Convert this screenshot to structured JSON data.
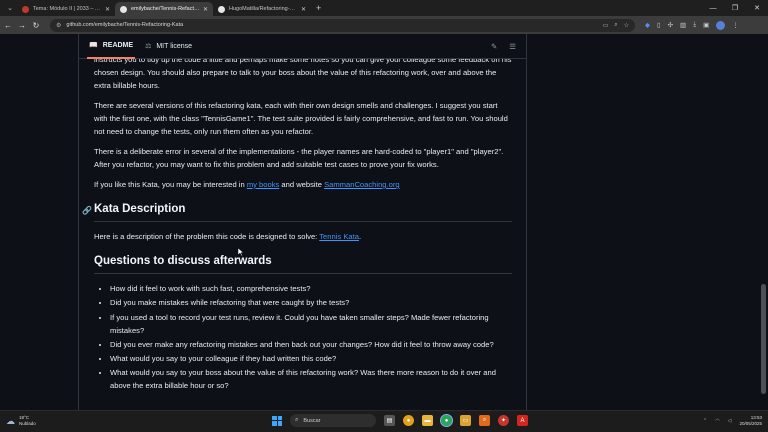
{
  "browser": {
    "tabs": [
      {
        "label": "Tema: Módulo II | 2033 – AMPI: ...",
        "active": false,
        "favicon_color": "#c0392b"
      },
      {
        "label": "emilybache/Tennis-Refactoring-...",
        "active": true,
        "favicon_color": "#e6e6e6"
      },
      {
        "label": "HugoMatilla/Refactoring-Samm...",
        "active": false,
        "favicon_color": "#e6e6e6"
      }
    ],
    "url": "github.com/emilybache/Tennis-Refactoring-Kata"
  },
  "readme": {
    "tab_readme": "README",
    "tab_license": "MIT license",
    "intro_partial": "Unfortunately he has now taken ill. He says he has completed the work, and the tests all pass. Your boss has asked you to take over from him. She wants you to spend an hour or so on the code so she can bill the client for the full 10 hours. She instructs you to tidy up the code a little and perhaps make some notes so you can give your colleague some feedback on his chosen design. You should also prepare to talk to your boss about the value of this refactoring work, over and above the extra billable hours.",
    "para_versions": "There are several versions of this refactoring kata, each with their own design smells and challenges. I suggest you start with the first one, with the class \"TennisGame1\". The test suite provided is fairly comprehensive, and fast to run. You should not need to change the tests, only run them often as you refactor.",
    "para_error": "There is a deliberate error in several of the implementations - the player names are hard-coded to \"player1\" and \"player2\". After you refactor, you may want to fix this problem and add suitable test cases to prove your fix works.",
    "like_prefix": "If you like this Kata, you may be interested in ",
    "like_link1": "my books",
    "like_mid": " and website ",
    "like_link2": "SammanCoaching.org",
    "h_kata": "Kata Description",
    "kata_prefix": "Here is a description of the problem this code is designed to solve: ",
    "kata_link": "Tennis Kata",
    "kata_suffix": ".",
    "h_questions": "Questions to discuss afterwards",
    "questions": [
      "How did it feel to work with such fast, comprehensive tests?",
      "Did you make mistakes while refactoring that were caught by the tests?",
      "If you used a tool to record your test runs, review it. Could you have taken smaller steps? Made fewer refactoring mistakes?",
      "Did you ever make any refactoring mistakes and then back out your changes? How did it feel to throw away code?",
      "What would you say to your colleague if they had written this code?",
      "What would you say to your boss about the value of this refactoring work? Was there more reason to do it over and above the extra billable hour or so?"
    ]
  },
  "taskbar": {
    "weather_temp": "18°C",
    "weather_desc": "Nublado",
    "search_placeholder": "Buscar",
    "time": "13:53",
    "date": "20/05/2025"
  }
}
